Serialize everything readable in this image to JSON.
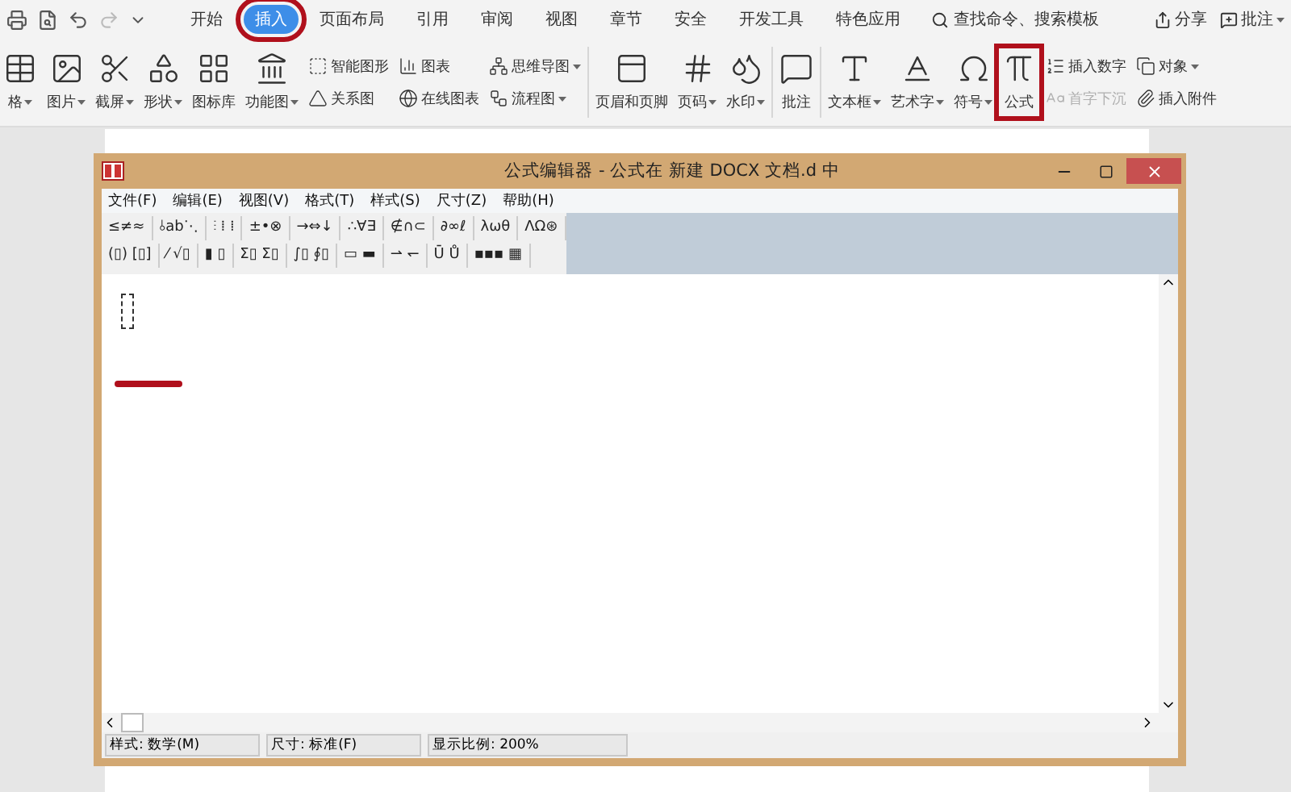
{
  "menu_tabs": [
    {
      "label": "开始",
      "selected": false,
      "highlighted": false
    },
    {
      "label": "插入",
      "selected": true,
      "highlighted": true
    },
    {
      "label": "页面布局",
      "selected": false,
      "highlighted": false
    },
    {
      "label": "引用",
      "selected": false,
      "highlighted": false
    },
    {
      "label": "审阅",
      "selected": false,
      "highlighted": false
    },
    {
      "label": "视图",
      "selected": false,
      "highlighted": false
    },
    {
      "label": "章节",
      "selected": false,
      "highlighted": false
    },
    {
      "label": "安全",
      "selected": false,
      "highlighted": false
    },
    {
      "label": "开发工具",
      "selected": false,
      "highlighted": false
    },
    {
      "label": "特色应用",
      "selected": false,
      "highlighted": false
    }
  ],
  "search": {
    "placeholder": "查找命令、搜索模板"
  },
  "top_actions": [
    {
      "label": "分享",
      "dropdown": false
    },
    {
      "label": "批注",
      "dropdown": true
    }
  ],
  "ribbon": [
    {
      "kind": "big",
      "label": "格",
      "dropdown": true,
      "highlighted": false
    },
    {
      "kind": "big",
      "label": "图片",
      "dropdown": true,
      "highlighted": false
    },
    {
      "kind": "big",
      "label": "截屏",
      "dropdown": true,
      "highlighted": false
    },
    {
      "kind": "big",
      "label": "形状",
      "dropdown": true,
      "highlighted": false
    },
    {
      "kind": "big",
      "label": "图标库",
      "dropdown": false,
      "highlighted": false
    },
    {
      "kind": "big",
      "label": "功能图",
      "dropdown": true,
      "highlighted": false
    },
    {
      "kind": "pair",
      "items": [
        {
          "label": "智能图形",
          "dropdown": false,
          "disabled": false
        },
        {
          "label": "关系图",
          "dropdown": false,
          "disabled": false
        }
      ]
    },
    {
      "kind": "pair",
      "items": [
        {
          "label": "图表",
          "dropdown": false,
          "disabled": false
        },
        {
          "label": "在线图表",
          "dropdown": false,
          "disabled": false
        }
      ]
    },
    {
      "kind": "pair",
      "items": [
        {
          "label": "思维导图",
          "dropdown": true,
          "disabled": false
        },
        {
          "label": "流程图",
          "dropdown": true,
          "disabled": false
        }
      ]
    },
    {
      "kind": "divider"
    },
    {
      "kind": "big",
      "label": "页眉和页脚",
      "dropdown": false,
      "highlighted": false
    },
    {
      "kind": "big",
      "label": "页码",
      "dropdown": true,
      "highlighted": false
    },
    {
      "kind": "big",
      "label": "水印",
      "dropdown": true,
      "highlighted": false
    },
    {
      "kind": "divider"
    },
    {
      "kind": "big",
      "label": "批注",
      "dropdown": false,
      "highlighted": false
    },
    {
      "kind": "divider"
    },
    {
      "kind": "big",
      "label": "文本框",
      "dropdown": true,
      "highlighted": false
    },
    {
      "kind": "big",
      "label": "艺术字",
      "dropdown": true,
      "highlighted": false
    },
    {
      "kind": "big",
      "label": "符号",
      "dropdown": true,
      "highlighted": false
    },
    {
      "kind": "big",
      "label": "公式",
      "dropdown": false,
      "highlighted": true
    },
    {
      "kind": "pair",
      "items": [
        {
          "label": "插入数字",
          "dropdown": false,
          "disabled": false
        },
        {
          "label": "首字下沉",
          "dropdown": false,
          "disabled": true
        }
      ]
    },
    {
      "kind": "pair",
      "items": [
        {
          "label": "对象",
          "dropdown": true,
          "disabled": false
        },
        {
          "label": "插入附件",
          "dropdown": false,
          "disabled": false
        }
      ]
    }
  ],
  "dialog": {
    "title": "公式编辑器 - 公式在 新建 DOCX 文档.d 中",
    "menu": [
      "文件(F)",
      "编辑(E)",
      "视图(V)",
      "格式(T)",
      "样式(S)",
      "尺寸(Z)",
      "帮助(H)"
    ],
    "palette_rows": [
      [
        "≤≠≈",
        "⫰ab⋱",
        "⫶ ⁞ ⁞",
        "±•⊗",
        "→⇔↓",
        "∴∀∃",
        "∉∩⊂",
        "∂∞ℓ",
        "λωθ",
        "ΛΩ⊛"
      ],
      [
        "(▯) [▯]",
        "⁄ √▯",
        "▮ ▯",
        "Σ▯ Σ▯",
        "∫▯ ∮▯",
        "▭ ▬",
        "⇀ ↽",
        "Ū Ů",
        "▪▪▪ ▦"
      ]
    ],
    "status": [
      "样式: 数学(M)",
      "尺寸: 标准(F)",
      "显示比例: 200%"
    ]
  }
}
